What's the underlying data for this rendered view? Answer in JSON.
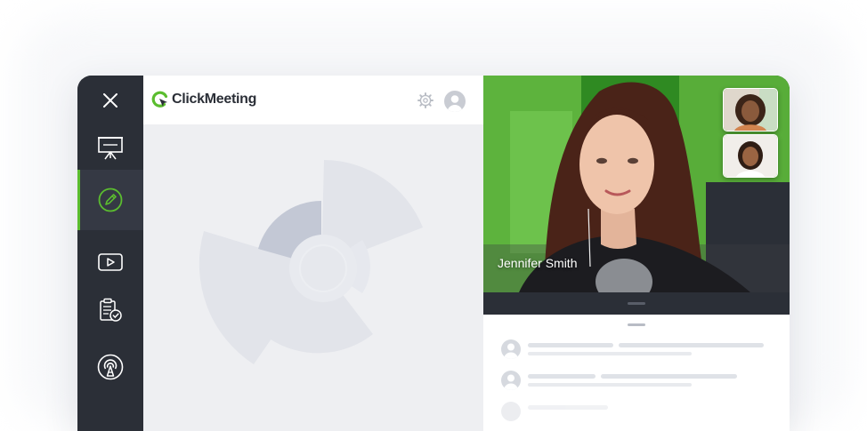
{
  "app": {
    "brand": "ClickMeeting",
    "colors": {
      "accent": "#5bbd2f",
      "sidebar": "#2b2f37",
      "board": "#eeeff2"
    }
  },
  "sidebar": {
    "items": [
      {
        "name": "close",
        "icon": "close-icon"
      },
      {
        "name": "presentation",
        "icon": "presentation-board-icon"
      },
      {
        "name": "whiteboard",
        "icon": "pencil-icon",
        "active": true
      },
      {
        "name": "video",
        "icon": "play-video-icon"
      },
      {
        "name": "tests",
        "icon": "clipboard-check-icon"
      },
      {
        "name": "broadcast",
        "icon": "broadcast-tower-icon"
      }
    ]
  },
  "header": {
    "settings_icon": "gear-icon",
    "user_icon": "user-avatar-icon"
  },
  "video": {
    "presenter_name": "Jennifer Smith",
    "thumbnails": [
      "participant-1",
      "participant-2"
    ]
  },
  "chat": {
    "rows": 3
  }
}
